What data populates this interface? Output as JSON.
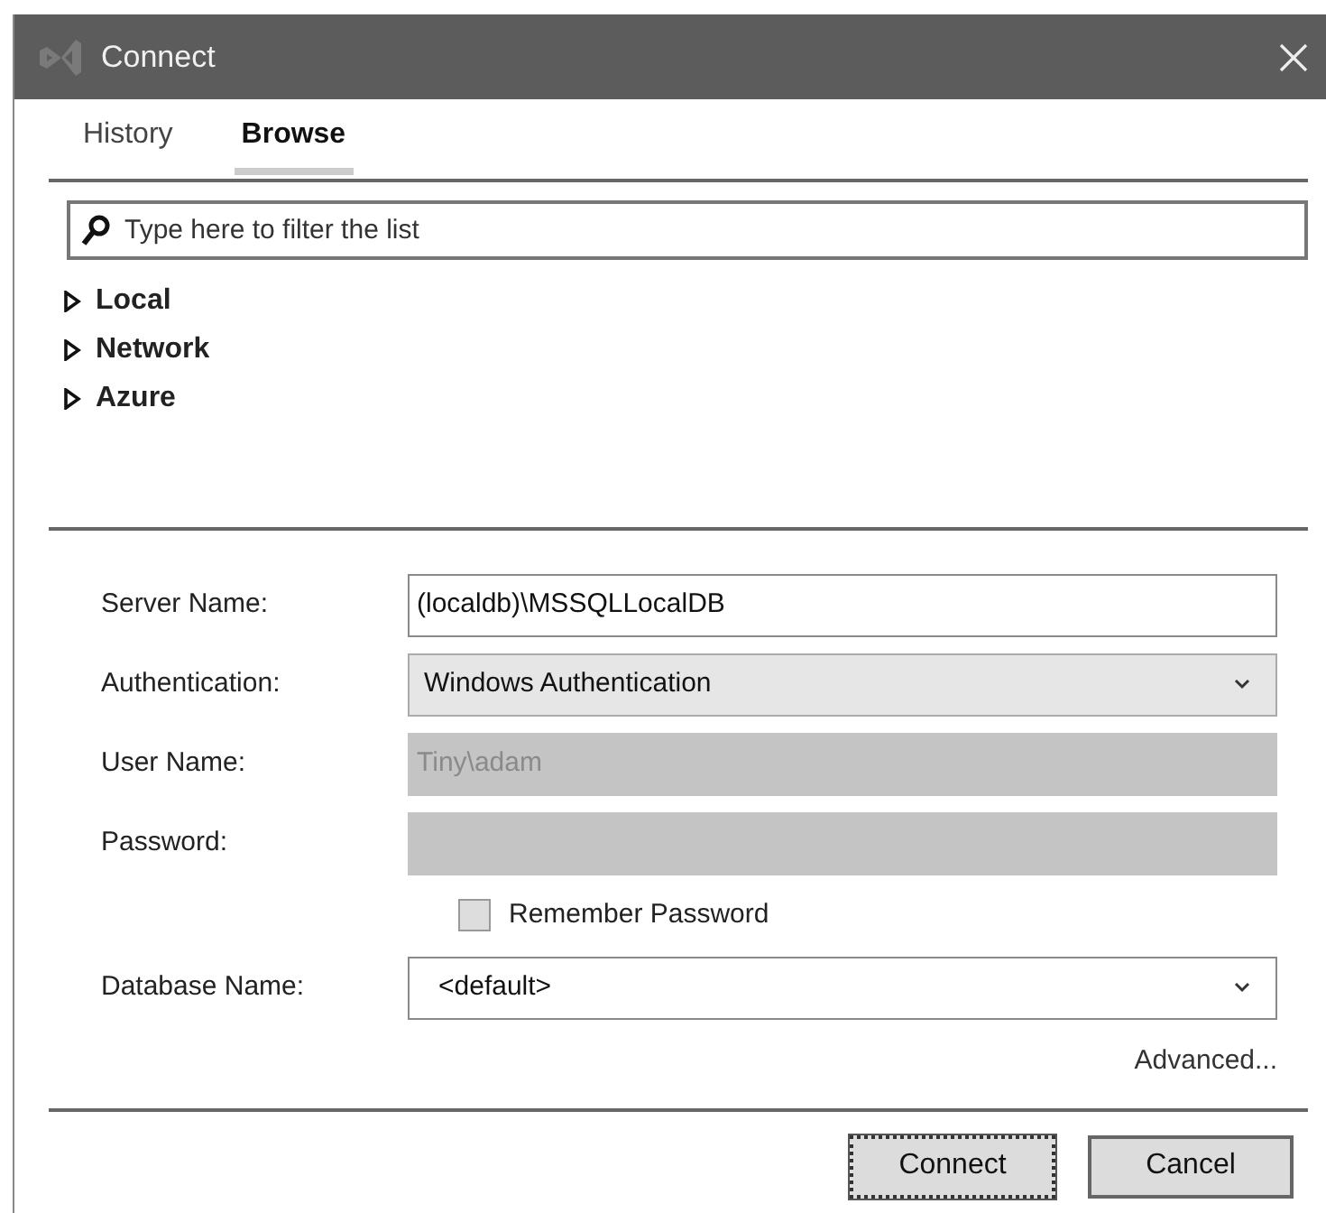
{
  "window": {
    "title": "Connect"
  },
  "tabs": [
    {
      "label": "History",
      "selected": false
    },
    {
      "label": "Browse",
      "selected": true
    }
  ],
  "filter": {
    "placeholder": "Type here to filter the list"
  },
  "tree": [
    {
      "label": "Local",
      "expanded": false
    },
    {
      "label": "Network",
      "expanded": false
    },
    {
      "label": "Azure",
      "expanded": false
    }
  ],
  "form": [
    {
      "kind": "text",
      "label": "Server Name:",
      "value": "(localdb)\\MSSQLLocalDB",
      "disabled": false
    },
    {
      "kind": "dropdown",
      "label": "Authentication:",
      "value": "Windows Authentication",
      "disabled": false
    },
    {
      "kind": "text",
      "label": "User Name:",
      "value": "Tiny\\adam",
      "disabled": true
    },
    {
      "kind": "text",
      "label": "Password:",
      "disabled": true
    },
    {
      "kind": "checkbox",
      "label": "Remember Password",
      "checked": false,
      "disabled": false
    },
    {
      "kind": "combo",
      "label": "Database Name:",
      "value": "<default>",
      "disabled": false
    }
  ],
  "advanced_link": "Advanced...",
  "buttons": [
    {
      "label": "Connect",
      "default": true
    },
    {
      "label": "Cancel",
      "default": false
    }
  ]
}
